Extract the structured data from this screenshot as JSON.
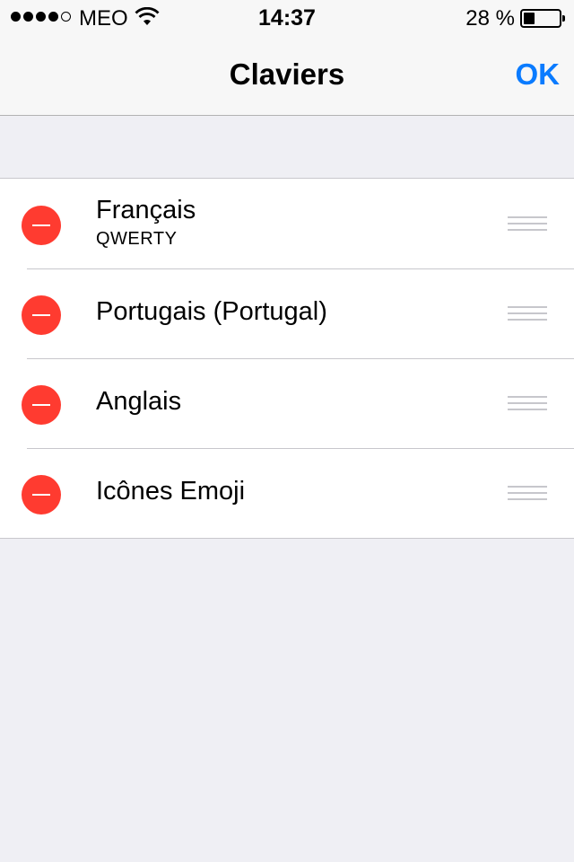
{
  "status_bar": {
    "signal_strength": "4/5",
    "carrier": "MEO",
    "wifi_icon": "wifi-icon",
    "time": "14:37",
    "battery_percent": "28 %",
    "battery_level": 0.28
  },
  "nav": {
    "title": "Claviers",
    "done_label": "OK",
    "accent_color": "#0a7bff"
  },
  "keyboards": [
    {
      "name": "Français",
      "layout": "QWERTY"
    },
    {
      "name": "Portugais (Portugal)"
    },
    {
      "name": "Anglais"
    },
    {
      "name": "Icônes Emoji"
    }
  ],
  "colors": {
    "delete": "#ff3b30",
    "background": "#efeff4"
  }
}
